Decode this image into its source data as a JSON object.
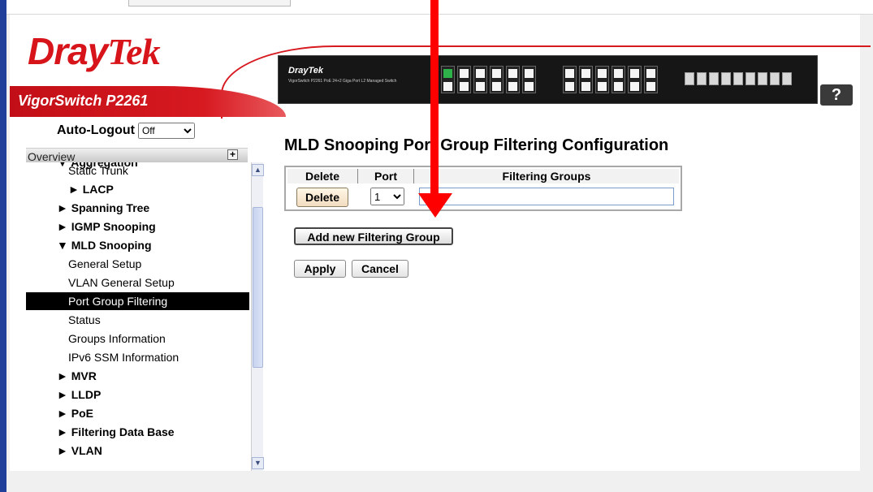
{
  "brand": {
    "logo_dray": "Dray",
    "logo_tek": "Tek",
    "model": "VigorSwitch P2261",
    "switch_brand": "DrayTek",
    "switch_sub": "VigorSwitch P2261\nPoE 24+2 Giga Port L2 Managed Switch"
  },
  "help": {
    "label": "?"
  },
  "sidebar": {
    "autologout_label": "Auto-Logout",
    "autologout_value": "Off",
    "overview_label": "Overview",
    "items": [
      {
        "label": "▼ Aggregation",
        "bold": true
      },
      {
        "label": "Static Trunk",
        "bold": false
      },
      {
        "label": "► LACP",
        "bold": true
      },
      {
        "label": "► Spanning Tree",
        "bold": true
      },
      {
        "label": "► IGMP Snooping",
        "bold": true
      },
      {
        "label": "▼ MLD Snooping",
        "bold": true
      },
      {
        "label": "General Setup",
        "bold": false
      },
      {
        "label": "VLAN General Setup",
        "bold": false
      },
      {
        "label": "Port Group Filtering",
        "bold": false,
        "selected": true
      },
      {
        "label": "Status",
        "bold": false
      },
      {
        "label": "Groups Information",
        "bold": false
      },
      {
        "label": "IPv6 SSM Information",
        "bold": false
      },
      {
        "label": "► MVR",
        "bold": true
      },
      {
        "label": "► LLDP",
        "bold": true
      },
      {
        "label": "► PoE",
        "bold": true
      },
      {
        "label": "► Filtering Data Base",
        "bold": true
      },
      {
        "label": "► VLAN",
        "bold": true
      }
    ]
  },
  "main": {
    "title": "MLD Snooping Port Group Filtering Configuration",
    "table": {
      "headers": [
        "Delete",
        "Port",
        "Filtering Groups"
      ],
      "row": {
        "delete_label": "Delete",
        "port_value": "1",
        "groups_value": ""
      }
    },
    "add_label": "Add new Filtering Group",
    "apply_label": "Apply",
    "cancel_label": "Cancel"
  },
  "colors": {
    "brand_red": "#d71920",
    "annotation_arrow": "#ff0000",
    "selected_bg": "#000000"
  }
}
